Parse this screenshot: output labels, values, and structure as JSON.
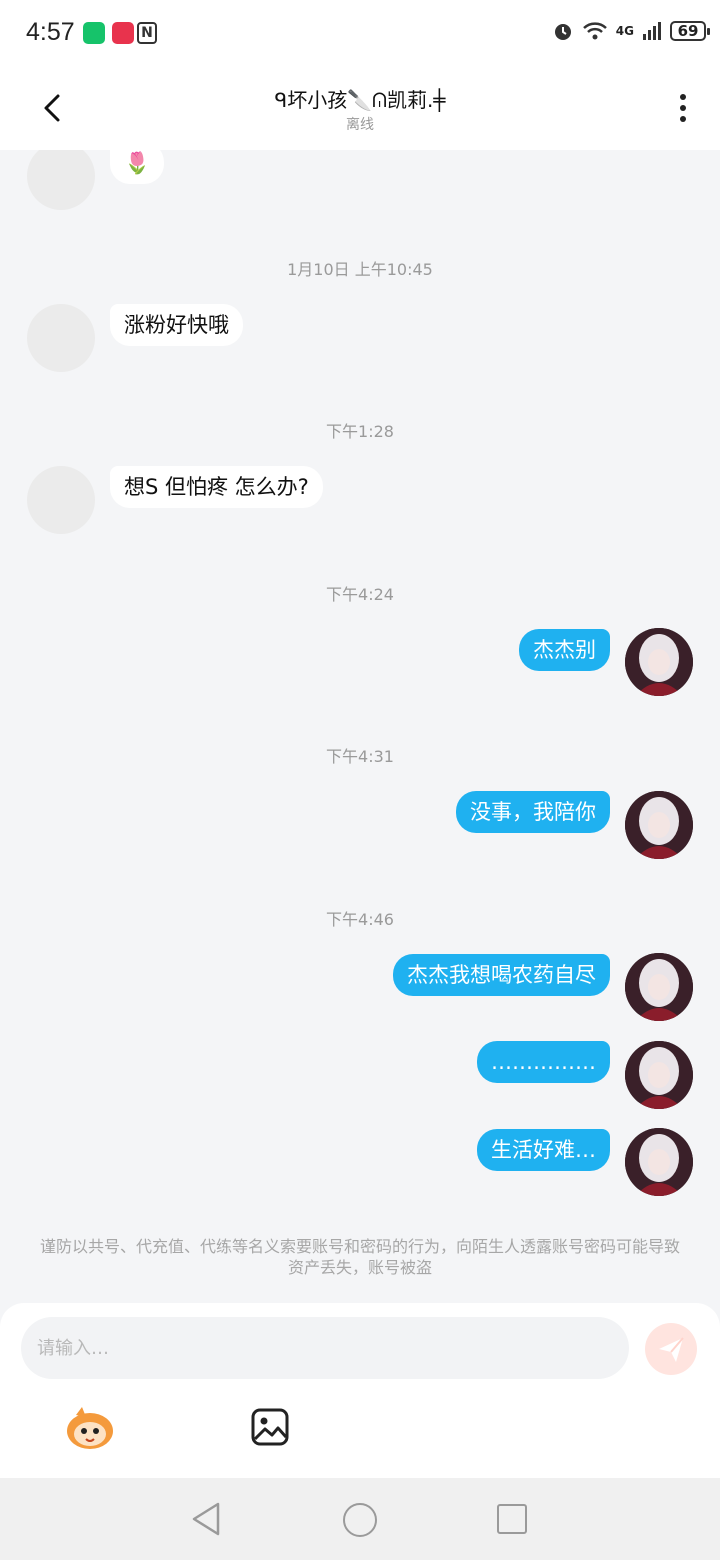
{
  "status_bar": {
    "time": "4:57",
    "network": "4G",
    "battery": "69"
  },
  "header": {
    "title": "ᑫ坏小孩🔪ᕬ凯莉.╪",
    "subtitle": "离线"
  },
  "timestamps": [
    "1月10日 上午10:45",
    "下午1:28",
    "下午4:24",
    "下午4:31",
    "下午4:46"
  ],
  "messages": [
    {
      "side": "in",
      "text": "🌷"
    },
    {
      "side": "in",
      "text": "涨粉好快哦"
    },
    {
      "side": "in",
      "text": "想S  但怕疼  怎么办?"
    },
    {
      "side": "out",
      "text": "杰杰别"
    },
    {
      "side": "out",
      "text": "没事，我陪你"
    },
    {
      "side": "out",
      "text": "杰杰我想喝农药自尽"
    },
    {
      "side": "out",
      "text": "……………"
    },
    {
      "side": "out",
      "text": "生活好难…"
    }
  ],
  "security_notice": "谨防以共号、代充值、代练等名义索要账号和密码的行为，向陌生人透露账号密码可能导致资产丢失，账号被盗",
  "composer": {
    "placeholder": "请输入…",
    "value": ""
  },
  "colors": {
    "outgoing_bubble": "#1fb1f0",
    "incoming_bubble": "#ffffff",
    "background": "#f4f5f7",
    "send_button": "#ffe4df"
  },
  "icons": [
    "back-arrow-icon",
    "more-vertical-icon",
    "send-icon",
    "mascot-emoji-icon",
    "image-icon",
    "nav-back-icon",
    "nav-home-icon",
    "nav-recent-icon"
  ]
}
